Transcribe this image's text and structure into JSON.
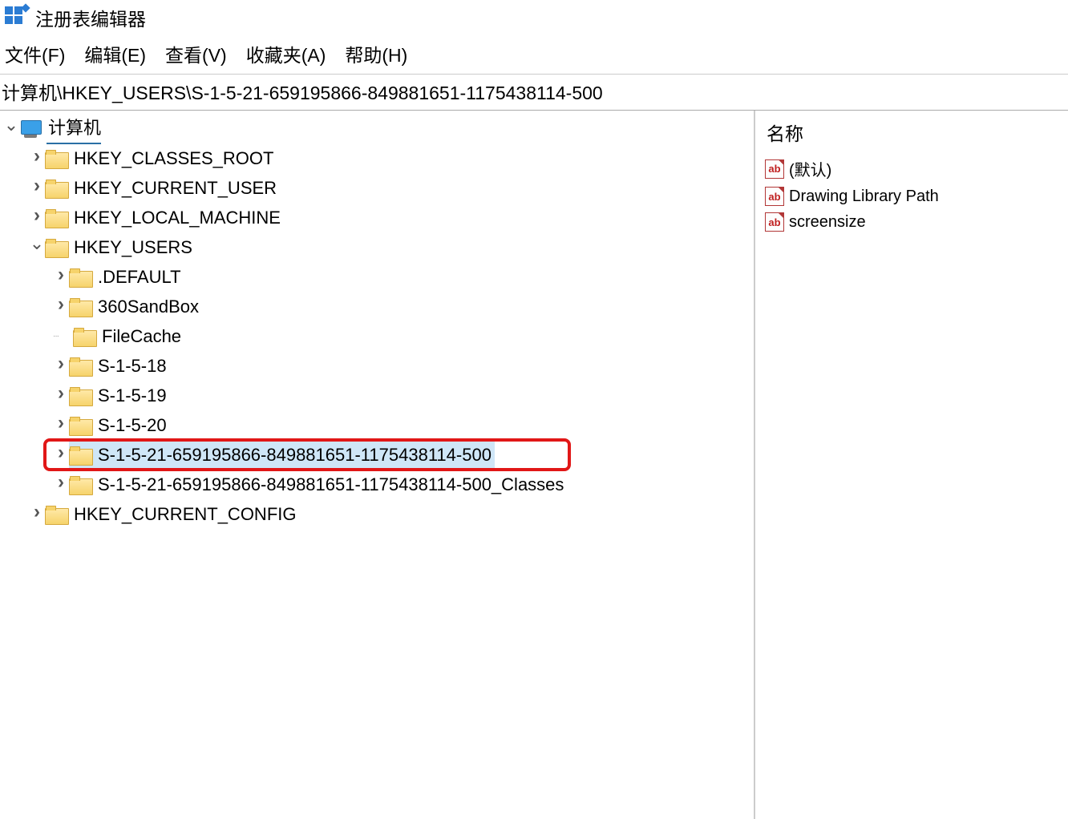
{
  "window": {
    "title": "注册表编辑器"
  },
  "menu": {
    "file": "文件(F)",
    "edit": "编辑(E)",
    "view": "查看(V)",
    "favorites": "收藏夹(A)",
    "help": "帮助(H)"
  },
  "address": "计算机\\HKEY_USERS\\S-1-5-21-659195866-849881651-1175438114-500",
  "tree": {
    "root": "计算机",
    "hkcr": "HKEY_CLASSES_ROOT",
    "hkcu": "HKEY_CURRENT_USER",
    "hklm": "HKEY_LOCAL_MACHINE",
    "hku": "HKEY_USERS",
    "hku_children": {
      "default": ".DEFAULT",
      "sandbox": "360SandBox",
      "filecache": "FileCache",
      "s18": "S-1-5-18",
      "s19": "S-1-5-19",
      "s20": "S-1-5-20",
      "sid": "S-1-5-21-659195866-849881651-1175438114-500",
      "sid_classes": "S-1-5-21-659195866-849881651-1175438114-500_Classes"
    },
    "hkcc": "HKEY_CURRENT_CONFIG"
  },
  "list": {
    "header_name": "名称",
    "rows": {
      "default": "(默认)",
      "drawing": "Drawing Library Path",
      "screensize": "screensize"
    }
  },
  "icon_text": {
    "ab": "ab"
  }
}
